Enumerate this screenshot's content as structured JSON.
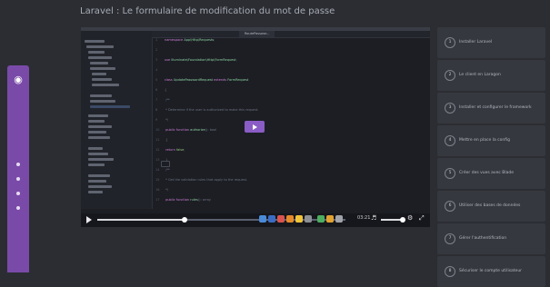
{
  "header": {
    "title": "Laravel : Le formulaire de modification du mot de passe",
    "subtitle": ""
  },
  "ide": {
    "active_tab": "RoutePasswor...",
    "code_lines": [
      {
        "n": "1",
        "parts": [
          [
            "kw",
            "namespace "
          ],
          [
            "fn",
            "App\\Http\\Requests"
          ],
          [
            "cm",
            ";"
          ]
        ]
      },
      {
        "n": "2",
        "parts": [
          [
            "cm",
            ""
          ]
        ]
      },
      {
        "n": "3",
        "parts": [
          [
            "kw",
            "use "
          ],
          [
            "fn",
            "Illuminate\\Foundation\\Http\\FormRequest"
          ],
          [
            "cm",
            ";"
          ]
        ]
      },
      {
        "n": "4",
        "parts": [
          [
            "cm",
            ""
          ]
        ]
      },
      {
        "n": "5",
        "parts": [
          [
            "kw",
            "class "
          ],
          [
            "fn",
            "UpdatePasswordRequest "
          ],
          [
            "kw",
            "extends "
          ],
          [
            "fn",
            "FormRequest"
          ]
        ]
      },
      {
        "n": "6",
        "parts": [
          [
            "cm",
            "{"
          ]
        ]
      },
      {
        "n": "7",
        "parts": [
          [
            "cm",
            "    /**"
          ]
        ]
      },
      {
        "n": "8",
        "parts": [
          [
            "cm",
            "     * Determine if the user is authorized to make this request."
          ]
        ]
      },
      {
        "n": "9",
        "parts": [
          [
            "cm",
            "     */"
          ]
        ]
      },
      {
        "n": "10",
        "parts": [
          [
            "kw",
            "    public function "
          ],
          [
            "fn",
            "authorize"
          ],
          [
            "cm",
            "(): bool"
          ]
        ]
      },
      {
        "n": "11",
        "parts": [
          [
            "cm",
            "    {"
          ]
        ]
      },
      {
        "n": "12",
        "parts": [
          [
            "kw",
            "        return "
          ],
          [
            "str",
            "false"
          ],
          [
            "cm",
            ";"
          ]
        ]
      },
      {
        "n": "13",
        "parts": [
          [
            "cm",
            "    }"
          ]
        ]
      },
      {
        "n": "14",
        "parts": [
          [
            "cm",
            "    /**"
          ]
        ]
      },
      {
        "n": "15",
        "parts": [
          [
            "cm",
            "     * Get the validation rules that apply to the request."
          ]
        ]
      },
      {
        "n": "16",
        "parts": [
          [
            "cm",
            "     */"
          ]
        ]
      },
      {
        "n": "17",
        "parts": [
          [
            "kw",
            "    public function "
          ],
          [
            "fn",
            "rules"
          ],
          [
            "cm",
            "(): array"
          ]
        ]
      }
    ]
  },
  "player": {
    "progress": 0.35,
    "volume": 0.85,
    "time": "03:21",
    "play_label": "play-icon",
    "volume_icon": "volume-icon",
    "settings_icon": "gear-icon",
    "fullscreen_icon": "fullscreen-icon"
  },
  "lessons": [
    {
      "num": "1",
      "title": "Installer Laravel"
    },
    {
      "num": "2",
      "title": "Le client en Laragon"
    },
    {
      "num": "3",
      "title": "Installer et configurer le framework"
    },
    {
      "num": "4",
      "title": "Mettre en place la config"
    },
    {
      "num": "5",
      "title": "Créer des vues avec Blade"
    },
    {
      "num": "6",
      "title": "Utiliser des bases de données"
    },
    {
      "num": "7",
      "title": "Gérer l'authentification"
    },
    {
      "num": "8",
      "title": "Sécuriser le compte utilisateur"
    }
  ],
  "colors": {
    "accent": "#7a4aa8",
    "background": "#2b2d33",
    "lesson_card": "#36383f"
  }
}
